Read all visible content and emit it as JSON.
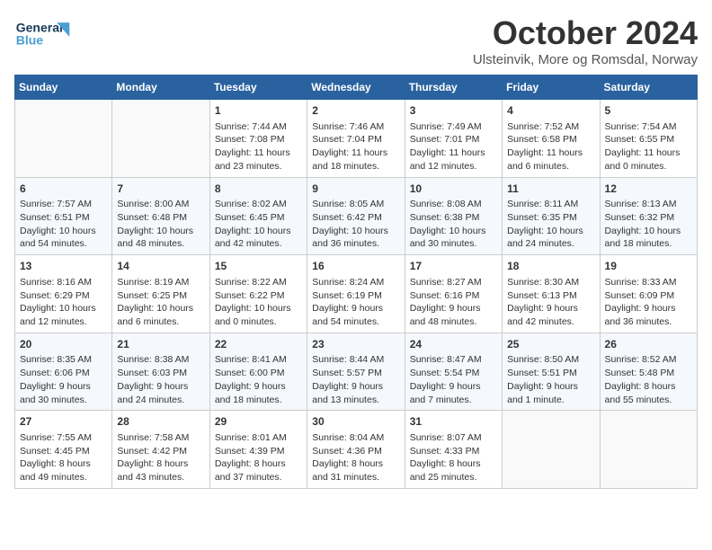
{
  "header": {
    "logo_text_general": "General",
    "logo_text_blue": "Blue",
    "month": "October 2024",
    "location": "Ulsteinvik, More og Romsdal, Norway"
  },
  "days_of_week": [
    "Sunday",
    "Monday",
    "Tuesday",
    "Wednesday",
    "Thursday",
    "Friday",
    "Saturday"
  ],
  "weeks": [
    [
      {
        "day": "",
        "info": ""
      },
      {
        "day": "",
        "info": ""
      },
      {
        "day": "1",
        "info": "Sunrise: 7:44 AM\nSunset: 7:08 PM\nDaylight: 11 hours\nand 23 minutes."
      },
      {
        "day": "2",
        "info": "Sunrise: 7:46 AM\nSunset: 7:04 PM\nDaylight: 11 hours\nand 18 minutes."
      },
      {
        "day": "3",
        "info": "Sunrise: 7:49 AM\nSunset: 7:01 PM\nDaylight: 11 hours\nand 12 minutes."
      },
      {
        "day": "4",
        "info": "Sunrise: 7:52 AM\nSunset: 6:58 PM\nDaylight: 11 hours\nand 6 minutes."
      },
      {
        "day": "5",
        "info": "Sunrise: 7:54 AM\nSunset: 6:55 PM\nDaylight: 11 hours\nand 0 minutes."
      }
    ],
    [
      {
        "day": "6",
        "info": "Sunrise: 7:57 AM\nSunset: 6:51 PM\nDaylight: 10 hours\nand 54 minutes."
      },
      {
        "day": "7",
        "info": "Sunrise: 8:00 AM\nSunset: 6:48 PM\nDaylight: 10 hours\nand 48 minutes."
      },
      {
        "day": "8",
        "info": "Sunrise: 8:02 AM\nSunset: 6:45 PM\nDaylight: 10 hours\nand 42 minutes."
      },
      {
        "day": "9",
        "info": "Sunrise: 8:05 AM\nSunset: 6:42 PM\nDaylight: 10 hours\nand 36 minutes."
      },
      {
        "day": "10",
        "info": "Sunrise: 8:08 AM\nSunset: 6:38 PM\nDaylight: 10 hours\nand 30 minutes."
      },
      {
        "day": "11",
        "info": "Sunrise: 8:11 AM\nSunset: 6:35 PM\nDaylight: 10 hours\nand 24 minutes."
      },
      {
        "day": "12",
        "info": "Sunrise: 8:13 AM\nSunset: 6:32 PM\nDaylight: 10 hours\nand 18 minutes."
      }
    ],
    [
      {
        "day": "13",
        "info": "Sunrise: 8:16 AM\nSunset: 6:29 PM\nDaylight: 10 hours\nand 12 minutes."
      },
      {
        "day": "14",
        "info": "Sunrise: 8:19 AM\nSunset: 6:25 PM\nDaylight: 10 hours\nand 6 minutes."
      },
      {
        "day": "15",
        "info": "Sunrise: 8:22 AM\nSunset: 6:22 PM\nDaylight: 10 hours\nand 0 minutes."
      },
      {
        "day": "16",
        "info": "Sunrise: 8:24 AM\nSunset: 6:19 PM\nDaylight: 9 hours\nand 54 minutes."
      },
      {
        "day": "17",
        "info": "Sunrise: 8:27 AM\nSunset: 6:16 PM\nDaylight: 9 hours\nand 48 minutes."
      },
      {
        "day": "18",
        "info": "Sunrise: 8:30 AM\nSunset: 6:13 PM\nDaylight: 9 hours\nand 42 minutes."
      },
      {
        "day": "19",
        "info": "Sunrise: 8:33 AM\nSunset: 6:09 PM\nDaylight: 9 hours\nand 36 minutes."
      }
    ],
    [
      {
        "day": "20",
        "info": "Sunrise: 8:35 AM\nSunset: 6:06 PM\nDaylight: 9 hours\nand 30 minutes."
      },
      {
        "day": "21",
        "info": "Sunrise: 8:38 AM\nSunset: 6:03 PM\nDaylight: 9 hours\nand 24 minutes."
      },
      {
        "day": "22",
        "info": "Sunrise: 8:41 AM\nSunset: 6:00 PM\nDaylight: 9 hours\nand 18 minutes."
      },
      {
        "day": "23",
        "info": "Sunrise: 8:44 AM\nSunset: 5:57 PM\nDaylight: 9 hours\nand 13 minutes."
      },
      {
        "day": "24",
        "info": "Sunrise: 8:47 AM\nSunset: 5:54 PM\nDaylight: 9 hours\nand 7 minutes."
      },
      {
        "day": "25",
        "info": "Sunrise: 8:50 AM\nSunset: 5:51 PM\nDaylight: 9 hours\nand 1 minute."
      },
      {
        "day": "26",
        "info": "Sunrise: 8:52 AM\nSunset: 5:48 PM\nDaylight: 8 hours\nand 55 minutes."
      }
    ],
    [
      {
        "day": "27",
        "info": "Sunrise: 7:55 AM\nSunset: 4:45 PM\nDaylight: 8 hours\nand 49 minutes."
      },
      {
        "day": "28",
        "info": "Sunrise: 7:58 AM\nSunset: 4:42 PM\nDaylight: 8 hours\nand 43 minutes."
      },
      {
        "day": "29",
        "info": "Sunrise: 8:01 AM\nSunset: 4:39 PM\nDaylight: 8 hours\nand 37 minutes."
      },
      {
        "day": "30",
        "info": "Sunrise: 8:04 AM\nSunset: 4:36 PM\nDaylight: 8 hours\nand 31 minutes."
      },
      {
        "day": "31",
        "info": "Sunrise: 8:07 AM\nSunset: 4:33 PM\nDaylight: 8 hours\nand 25 minutes."
      },
      {
        "day": "",
        "info": ""
      },
      {
        "day": "",
        "info": ""
      }
    ]
  ]
}
